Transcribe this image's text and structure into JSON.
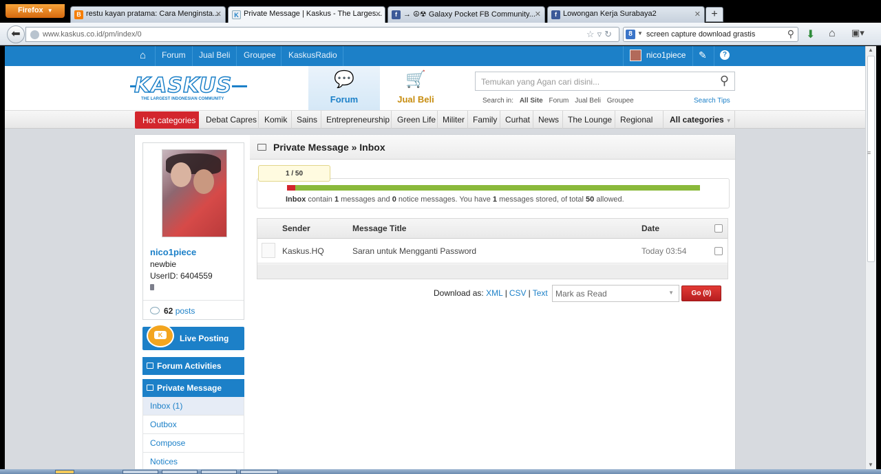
{
  "browser": {
    "menu_label": "Firefox",
    "tabs": [
      {
        "title": "restu kayan pratama: Cara Menginsta...",
        "favicon": "B"
      },
      {
        "title": "Private Message | Kaskus - The Larges...",
        "favicon": "K"
      },
      {
        "title": "→ ☮☢ Galaxy Pocket FB Community...",
        "favicon": "f"
      },
      {
        "title": "Lowongan Kerja Surabaya2",
        "favicon": "f"
      }
    ],
    "url": "www.kaskus.co.id/pm/index/0",
    "search_text": "screen capture download grastis",
    "search_engine_icon": "8"
  },
  "topnav": {
    "links": [
      "Forum",
      "Jual Beli",
      "Groupee",
      "KaskusRadio"
    ],
    "username": "nico1piece"
  },
  "header": {
    "logo_text": "KASKUS",
    "logo_tagline": "THE LARGEST INDONESIAN COMMUNITY",
    "forum_label": "Forum",
    "jualbeli_label": "Jual Beli",
    "search_placeholder": "Temukan yang Agan cari disini...",
    "search_in_label": "Search in:",
    "search_scopes": [
      "All Site",
      "Forum",
      "Jual Beli",
      "Groupee"
    ],
    "search_tips": "Search Tips"
  },
  "categories": {
    "hot_label": "Hot categories",
    "items": [
      "Debat Capres",
      "Komik",
      "Sains",
      "Entrepreneurship",
      "Green Life",
      "Militer",
      "Family",
      "Curhat",
      "News",
      "The Lounge",
      "Regional"
    ],
    "all_label": "All categories"
  },
  "profile": {
    "name": "nico1piece",
    "rank": "newbie",
    "user_id": "UserID: 6404559",
    "post_count": "62",
    "posts_label": "posts"
  },
  "sidebar": {
    "live_posting": "Live Posting",
    "forum_activities": "Forum Activities",
    "private_message": "Private Message",
    "links": [
      "Inbox (1)",
      "Outbox",
      "Compose",
      "Notices"
    ]
  },
  "main": {
    "title": "Private Message » Inbox",
    "quota_label": "1 / 50",
    "quota_fraction": 0.02,
    "quota_text": {
      "folder": "Inbox",
      "t1": " contain ",
      "messages": "1",
      "t2": " messages and ",
      "notices": "0",
      "t3": " notice messages. You have ",
      "stored": "1",
      "t4": " messages stored, of total ",
      "total": "50",
      "t5": " allowed."
    },
    "columns": {
      "sender": "Sender",
      "title": "Message Title",
      "date": "Date"
    },
    "messages": [
      {
        "sender": "Kaskus.HQ",
        "title": "Saran untuk Mengganti Password",
        "date": "Today 03:54"
      }
    ],
    "download_label": "Download as:",
    "download_formats": [
      "XML",
      "CSV",
      "Text"
    ],
    "action_select": "Mark as Read",
    "go_label": "Go (0)"
  },
  "colors": {
    "brand_blue": "#1c80c8",
    "hot_red": "#d3262d",
    "quota_green": "#8ab93b"
  }
}
